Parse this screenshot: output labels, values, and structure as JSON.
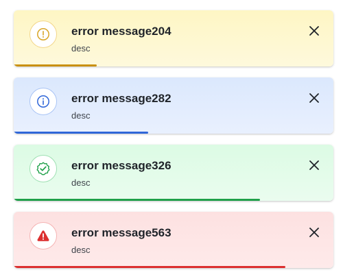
{
  "toasts": [
    {
      "type": "warning",
      "title": "error message204",
      "desc": "desc",
      "accent_color": "#c9900f",
      "icon": "warning-circle-icon",
      "progress_pct": 26
    },
    {
      "type": "info",
      "title": "error message282",
      "desc": "desc",
      "accent_color": "#2f66d8",
      "icon": "info-circle-icon",
      "progress_pct": 42
    },
    {
      "type": "success",
      "title": "error message326",
      "desc": "desc",
      "accent_color": "#20a04a",
      "icon": "check-badge-icon",
      "progress_pct": 77
    },
    {
      "type": "error",
      "title": "error message563",
      "desc": "desc",
      "accent_color": "#dc2f2f",
      "icon": "alert-triangle-icon",
      "progress_pct": 85
    }
  ]
}
